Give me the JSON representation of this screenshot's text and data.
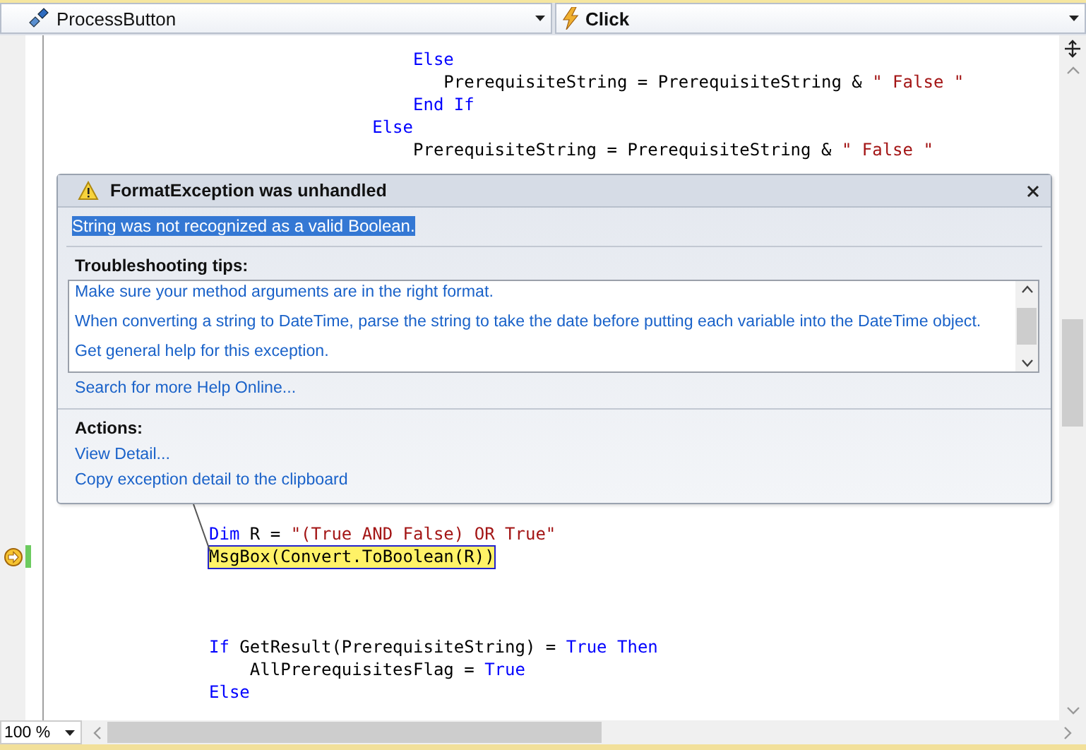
{
  "editor": {
    "type_dropdown": {
      "value": "ProcessButton"
    },
    "member_dropdown": {
      "value": "Click"
    },
    "code_blocks": [
      {
        "lines": [
          {
            "current": false,
            "tokens": [
              {
                "kind": "keyword",
                "text": "                    Else"
              }
            ]
          },
          {
            "current": false,
            "tokens": [
              {
                "kind": "plain",
                "text": "                       PrerequisiteString = PrerequisiteString & "
              },
              {
                "kind": "string",
                "text": "\" False \""
              }
            ]
          },
          {
            "current": false,
            "tokens": [
              {
                "kind": "keyword",
                "text": "                    End If"
              }
            ]
          },
          {
            "current": false,
            "tokens": [
              {
                "kind": "keyword",
                "text": "                Else"
              }
            ]
          },
          {
            "current": false,
            "tokens": [
              {
                "kind": "plain",
                "text": "                    PrerequisiteString = PrerequisiteString & "
              },
              {
                "kind": "string",
                "text": "\" False \""
              }
            ]
          }
        ]
      },
      {
        "lines": [
          {
            "current": false,
            "tokens": [
              {
                "kind": "keyword",
                "text": "Dim"
              },
              {
                "kind": "plain",
                "text": " R = "
              },
              {
                "kind": "string",
                "text": "\"(True AND False) OR True\""
              }
            ]
          },
          {
            "current": true,
            "tokens": [
              {
                "kind": "plain",
                "text": "MsgBox(Convert.ToBoolean(R))"
              }
            ]
          }
        ]
      },
      {
        "lines": [
          {
            "current": false,
            "tokens": [
              {
                "kind": "keyword",
                "text": "If"
              },
              {
                "kind": "plain",
                "text": " GetResult(PrerequisiteString) = "
              },
              {
                "kind": "keyword",
                "text": "True Then"
              }
            ]
          },
          {
            "current": false,
            "tokens": [
              {
                "kind": "plain",
                "text": "    AllPrerequisitesFlag = "
              },
              {
                "kind": "keyword",
                "text": "True"
              }
            ]
          },
          {
            "current": false,
            "tokens": [
              {
                "kind": "keyword",
                "text": "Else"
              }
            ]
          }
        ]
      }
    ],
    "zoom": {
      "value": "100 %"
    }
  },
  "exception_popup": {
    "title": "FormatException was unhandled",
    "message": "String was not recognized as a valid Boolean.",
    "message_selected": true,
    "tips_heading": "Troubleshooting tips:",
    "tips": [
      "Make sure your method arguments are in the right format.",
      "When converting a string to DateTime, parse the string to take the date before putting each variable into the DateTime object.",
      "Get general help for this exception."
    ],
    "search_link": "Search for more Help Online...",
    "actions_heading": "Actions:",
    "actions": [
      "View Detail...",
      "Copy exception detail to the clipboard"
    ]
  }
}
